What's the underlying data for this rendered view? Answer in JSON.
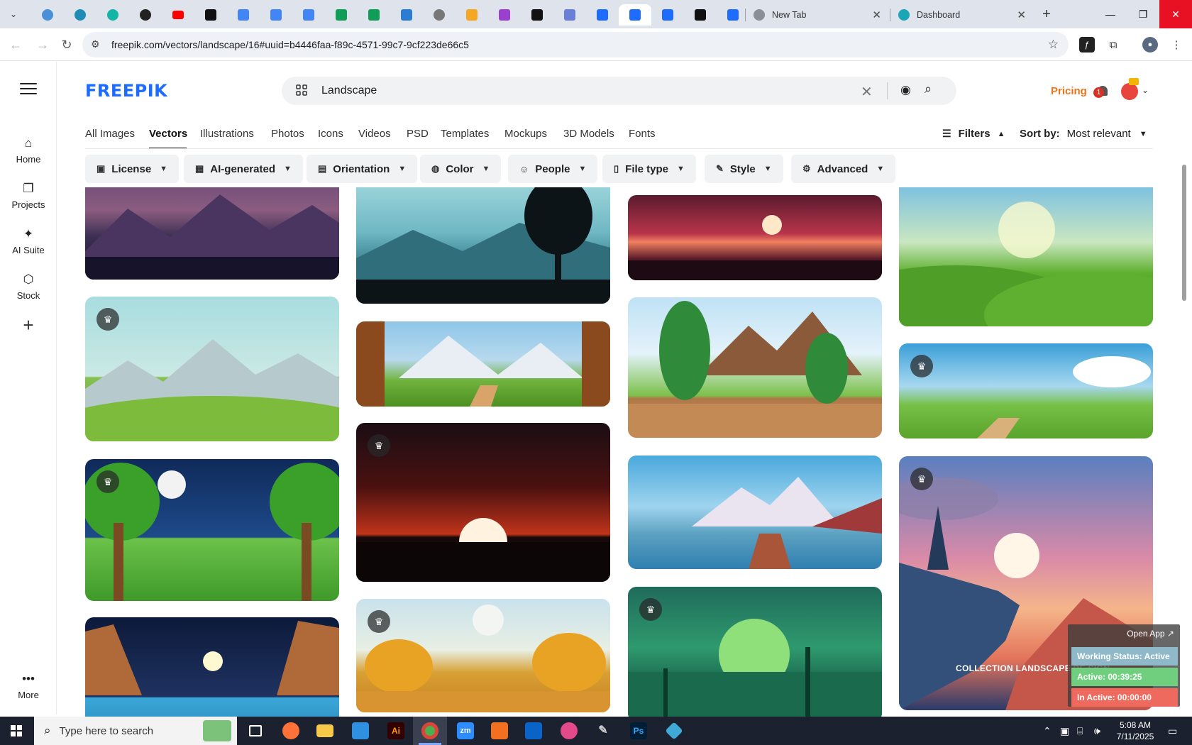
{
  "browser": {
    "pinned_tabs": [
      {
        "icon": "app-icon",
        "color": "#4a90d9"
      },
      {
        "icon": "shield-icon",
        "color": "#1e8cb5"
      },
      {
        "icon": "app-icon",
        "color": "#13b5a6"
      },
      {
        "icon": "openai-icon",
        "color": "#222222"
      },
      {
        "icon": "youtube-icon",
        "color": "#ff0000"
      },
      {
        "icon": "bolt-icon",
        "color": "#111111"
      },
      {
        "icon": "docs-icon",
        "color": "#4285f4"
      },
      {
        "icon": "docs-icon",
        "color": "#4285f4"
      },
      {
        "icon": "docs-icon",
        "color": "#4285f4"
      },
      {
        "icon": "sheets-icon",
        "color": "#0f9d58"
      },
      {
        "icon": "sheets-icon",
        "color": "#0f9d58"
      },
      {
        "icon": "word-icon",
        "color": "#2b7cd3"
      },
      {
        "icon": "globe-icon",
        "color": "#777777"
      },
      {
        "icon": "app-icon",
        "color": "#f5a623"
      },
      {
        "icon": "braces-icon",
        "color": "#9b3fcf"
      },
      {
        "icon": "app-icon",
        "color": "#111111"
      },
      {
        "icon": "grid-icon",
        "color": "#6a7fd8"
      },
      {
        "icon": "freepik-icon",
        "color": "#1d6bff"
      },
      {
        "icon": "freepik-icon",
        "color": "#1d6bff"
      },
      {
        "icon": "freepik-icon",
        "color": "#1d6bff"
      },
      {
        "icon": "medium-icon",
        "color": "#111111"
      },
      {
        "icon": "freepik-icon",
        "color": "#1d6bff"
      }
    ],
    "tabs": [
      {
        "title": "New Tab"
      },
      {
        "title": "Dashboard"
      }
    ],
    "url": "freepik.com/vectors/landscape/16#uuid=b4446faa-f89c-4571-99c7-9cf223de66c5"
  },
  "sidebar": {
    "items": [
      {
        "label": "Home",
        "icon": "home-icon"
      },
      {
        "label": "Projects",
        "icon": "projects-icon"
      },
      {
        "label": "AI Suite",
        "icon": "sparkle-icon"
      },
      {
        "label": "Stock",
        "icon": "stock-icon"
      }
    ],
    "more": "More"
  },
  "header": {
    "logo": "FREEPIK",
    "search_value": "Landscape",
    "pricing": "Pricing",
    "notification_count": "1"
  },
  "categories": [
    "All Images",
    "Vectors",
    "Illustrations",
    "Photos",
    "Icons",
    "Videos",
    "PSD",
    "Templates",
    "Mockups",
    "3D Models",
    "Fonts"
  ],
  "active_category": "Vectors",
  "filters_label": "Filters",
  "sort": {
    "label": "Sort by:",
    "value": "Most relevant"
  },
  "filter_chips": [
    {
      "label": "License",
      "icon": "license-icon"
    },
    {
      "label": "AI-generated",
      "icon": "ai-icon"
    },
    {
      "label": "Orientation",
      "icon": "orientation-icon"
    },
    {
      "label": "Color",
      "icon": "palette-icon"
    },
    {
      "label": "People",
      "icon": "people-icon"
    },
    {
      "label": "File type",
      "icon": "file-icon"
    },
    {
      "label": "Style",
      "icon": "brush-icon"
    },
    {
      "label": "Advanced",
      "icon": "gear-icon"
    }
  ],
  "results": [
    {
      "scene": "dusk mountains",
      "premium": false
    },
    {
      "scene": "green hills mountains",
      "premium": true
    },
    {
      "scene": "night fruit trees",
      "premium": true
    },
    {
      "scene": "canyon river night",
      "premium": false
    },
    {
      "scene": "teal mountains tree silhouette",
      "premium": true
    },
    {
      "scene": "forest frame mountains",
      "premium": false
    },
    {
      "scene": "red sunset",
      "premium": true
    },
    {
      "scene": "autumn field",
      "premium": true
    },
    {
      "scene": "sunset lake",
      "premium": false
    },
    {
      "scene": "park trees mountains",
      "premium": false
    },
    {
      "scene": "lake pier mountains",
      "premium": false
    },
    {
      "scene": "green sunset palms",
      "premium": true
    },
    {
      "scene": "sunburst hills",
      "premium": true
    },
    {
      "scene": "meadow path",
      "premium": true
    },
    {
      "scene": "cliff sunset",
      "premium": true,
      "caption": "COLLECTION LANDSCAPE DE SIGN"
    }
  ],
  "status_widget": {
    "open_app": "Open App ↗",
    "working_status": "Working Status: Active",
    "active": "Active: 00:39:25",
    "inactive": "In Active: 00:00:00"
  },
  "taskbar": {
    "search_placeholder": "Type here to search",
    "apps": [
      {
        "icon": "task-view-icon",
        "color": "#ffffff"
      },
      {
        "icon": "firefox-icon",
        "color": "#ff7139"
      },
      {
        "icon": "file-explorer-icon",
        "color": "#f7c948"
      },
      {
        "icon": "vscode-icon",
        "color": "#2f8fe0"
      },
      {
        "icon": "illustrator-icon",
        "color": "#ff9a00",
        "text": "Ai"
      },
      {
        "icon": "chrome-icon",
        "color": "#4caf50",
        "active": true
      },
      {
        "icon": "zoom-icon",
        "color": "#2d8cff",
        "text": "zm"
      },
      {
        "icon": "app-icon",
        "color": "#f37021"
      },
      {
        "icon": "outlook-icon",
        "color": "#0a64c8"
      },
      {
        "icon": "app-icon",
        "color": "#e24a8a"
      },
      {
        "icon": "pen-icon",
        "color": "#aaaaaa"
      },
      {
        "icon": "photoshop-icon",
        "color": "#31a8ff",
        "text": "Ps"
      },
      {
        "icon": "app-icon",
        "color": "#3fa9d8"
      }
    ],
    "time": "5:08 AM",
    "date": "7/11/2025"
  }
}
